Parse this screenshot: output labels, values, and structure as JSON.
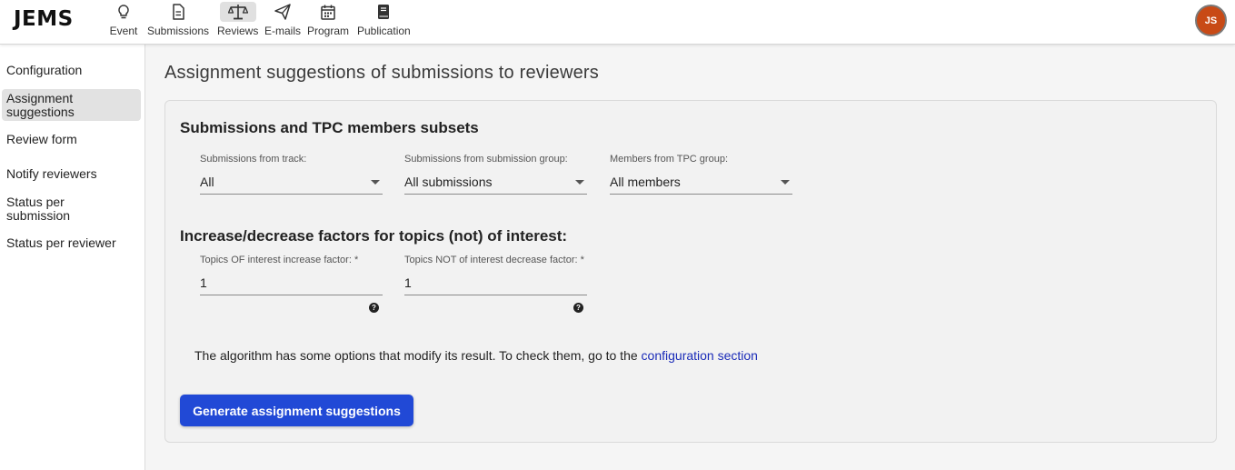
{
  "header": {
    "logo": "JEMS",
    "nav": [
      {
        "label": "Event",
        "icon": "lightbulb-icon"
      },
      {
        "label": "Submissions",
        "icon": "document-icon"
      },
      {
        "label": "Reviews",
        "icon": "scale-icon",
        "active": true
      },
      {
        "label": "E-mails",
        "icon": "paper-plane-icon"
      },
      {
        "label": "Program",
        "icon": "calendar-icon"
      },
      {
        "label": "Publication",
        "icon": "book-icon"
      }
    ],
    "avatar_initials": "JS"
  },
  "sidebar": {
    "items": [
      {
        "label": "Configuration"
      },
      {
        "label": "Assignment suggestions",
        "active": true
      },
      {
        "label": "Review form"
      },
      {
        "label": "Notify reviewers"
      },
      {
        "label": "Status per submission"
      },
      {
        "label": "Status per reviewer"
      }
    ]
  },
  "main": {
    "title": "Assignment suggestions of submissions to reviewers",
    "subsets": {
      "title": "Submissions and TPC members subsets",
      "track": {
        "label": "Submissions from track:",
        "value": "All"
      },
      "group": {
        "label": "Submissions from submission group:",
        "value": "All submissions"
      },
      "tpc": {
        "label": "Members from TPC group:",
        "value": "All members"
      }
    },
    "factors": {
      "title": "Increase/decrease factors for topics (not) of interest:",
      "increase": {
        "label": "Topics OF interest increase factor: *",
        "value": "1"
      },
      "decrease": {
        "label": "Topics NOT of interest decrease factor: *",
        "value": "1"
      }
    },
    "info_text": "The algorithm has some options that modify its result. To check them, go to the",
    "info_link": "configuration section",
    "generate_button": "Generate assignment suggestions"
  },
  "colors": {
    "primary_button": "#2149d6",
    "link": "#1a2bb8",
    "avatar": "#c84a16"
  }
}
